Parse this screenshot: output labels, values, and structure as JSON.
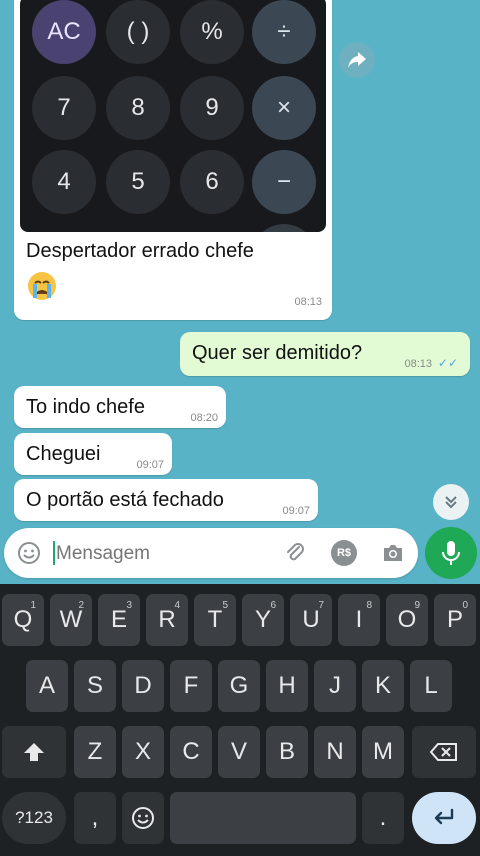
{
  "calculator": {
    "keys": [
      "AC",
      "( )",
      "%",
      "÷",
      "7",
      "8",
      "9",
      "×",
      "4",
      "5",
      "6",
      "−"
    ]
  },
  "messages": {
    "image_caption": "Despertador errado chefe",
    "image_time": "08:13",
    "m1": {
      "text": "Quer ser demitido?",
      "time": "08:13"
    },
    "m2": {
      "text": "To indo chefe",
      "time": "08:20"
    },
    "m3": {
      "text": "Cheguei",
      "time": "09:07"
    },
    "m4": {
      "text": "O portão está fechado",
      "time": "09:07"
    }
  },
  "input": {
    "placeholder": "Mensagem",
    "rs_label": "R$"
  },
  "keyboard": {
    "row1": [
      "Q",
      "W",
      "E",
      "R",
      "T",
      "Y",
      "U",
      "I",
      "O",
      "P"
    ],
    "row1_sup": [
      "1",
      "2",
      "3",
      "4",
      "5",
      "6",
      "7",
      "8",
      "9",
      "0"
    ],
    "row2": [
      "A",
      "S",
      "D",
      "F",
      "G",
      "H",
      "J",
      "K",
      "L"
    ],
    "row3": [
      "Z",
      "X",
      "C",
      "V",
      "B",
      "N",
      "M"
    ],
    "num_label": "?123",
    "comma": ",",
    "period": "."
  },
  "colors": {
    "chat_bg": "#58b3c6",
    "outgoing": "#e3fbd4",
    "send": "#1fa855",
    "calc_ac": "#4a4270"
  },
  "icons": [
    "forward-icon",
    "scroll-down-icon",
    "emoji-icon",
    "attach-icon",
    "camera-icon",
    "mic-icon",
    "shift-icon",
    "backspace-icon",
    "enter-icon",
    "emoji-key-icon"
  ]
}
